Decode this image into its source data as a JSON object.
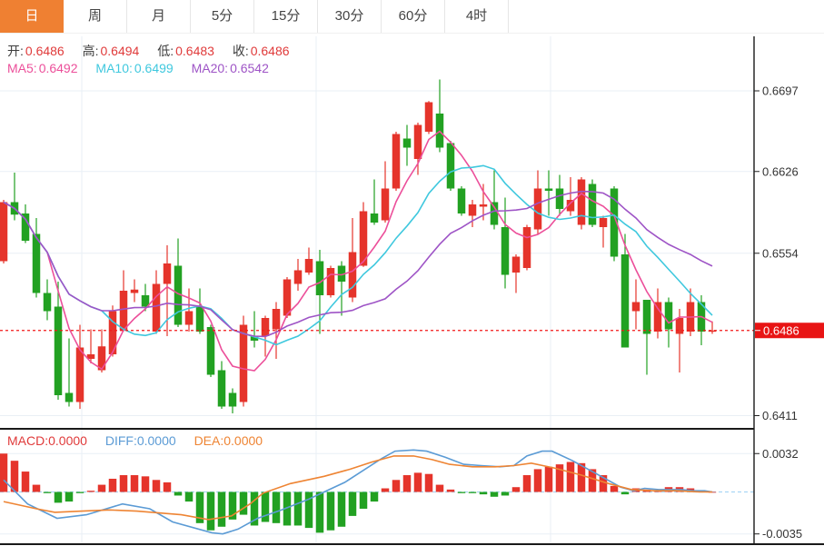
{
  "tabs": [
    {
      "name": "tab-day",
      "label": "日",
      "active": true
    },
    {
      "name": "tab-week",
      "label": "周",
      "active": false
    },
    {
      "name": "tab-month",
      "label": "月",
      "active": false
    },
    {
      "name": "tab-5min",
      "label": "5分",
      "active": false
    },
    {
      "name": "tab-15min",
      "label": "15分",
      "active": false
    },
    {
      "name": "tab-30min",
      "label": "30分",
      "active": false
    },
    {
      "name": "tab-60min",
      "label": "60分",
      "active": false
    },
    {
      "name": "tab-4hour",
      "label": "4时",
      "active": false
    }
  ],
  "ohlc": {
    "open_label": "开:",
    "open": "0.6486",
    "high_label": "高:",
    "high": "0.6494",
    "low_label": "低:",
    "low": "0.6483",
    "close_label": "收:",
    "close": "0.6486"
  },
  "ma": {
    "ma5_label": "MA5:",
    "ma5": "0.6492",
    "ma10_label": "MA10:",
    "ma10": "0.6499",
    "ma20_label": "MA20:",
    "ma20": "0.6542"
  },
  "macd_header": {
    "macd_label": "MACD:",
    "macd": "0.0000",
    "diff_label": "DIFF:",
    "diff": "0.0000",
    "dea_label": "DEA:",
    "dea": "0.0000"
  },
  "colors": {
    "up": "#e5342b",
    "down": "#22a122",
    "ma5": "#ec4f9a",
    "ma10": "#3fc8de",
    "ma20": "#9e54c6",
    "diff": "#5b9bd5",
    "dea": "#ee8433",
    "tab_active_bg": "#ef8032",
    "value_red": "#e03a3a",
    "price_line": "#f31919",
    "badge_bg": "#e81414",
    "zero_line": "#a9d7f5",
    "grid": "#e9eff5",
    "axis": "#1a1a1a",
    "text_dark": "#333333"
  },
  "chart_data": [
    {
      "type": "candlestick",
      "title": "daily K-line with MA overlays",
      "legend": [
        "MA5",
        "MA10",
        "MA20"
      ],
      "grid": true,
      "y_axis_side": "right",
      "y_ticks": [
        {
          "label": "0.6697",
          "value": 0.6697
        },
        {
          "label": "0.6626",
          "value": 0.6626
        },
        {
          "label": "0.6554",
          "value": 0.6554
        },
        {
          "label": "0.6411",
          "value": 0.6411
        }
      ],
      "current_price": {
        "label": "0.6486",
        "value": 0.6486
      },
      "ohlc_keys": [
        "open",
        "close",
        "low",
        "high"
      ],
      "candles": [
        [
          0.6547,
          0.6599,
          0.6545,
          0.6601
        ],
        [
          0.6599,
          0.6588,
          0.6583,
          0.6625
        ],
        [
          0.6589,
          0.6565,
          0.6563,
          0.6597
        ],
        [
          0.6571,
          0.6519,
          0.6515,
          0.6585
        ],
        [
          0.6519,
          0.6503,
          0.6495,
          0.6531
        ],
        [
          0.6507,
          0.6429,
          0.6425,
          0.6529
        ],
        [
          0.6431,
          0.6423,
          0.6419,
          0.6479
        ],
        [
          0.6423,
          0.6471,
          0.6417,
          0.6491
        ],
        [
          0.6461,
          0.6465,
          0.6457,
          0.6487
        ],
        [
          0.6451,
          0.6472,
          0.6449,
          0.6487
        ],
        [
          0.6465,
          0.6503,
          0.6463,
          0.6508
        ],
        [
          0.6486,
          0.6521,
          0.6485,
          0.6539
        ],
        [
          0.6519,
          0.6522,
          0.6511,
          0.6531
        ],
        [
          0.6517,
          0.6507,
          0.6503,
          0.6527
        ],
        [
          0.6485,
          0.6527,
          0.6483,
          0.6539
        ],
        [
          0.6527,
          0.6545,
          0.6481,
          0.6561
        ],
        [
          0.6543,
          0.6491,
          0.6489,
          0.6567
        ],
        [
          0.6491,
          0.6503,
          0.6485,
          0.6523
        ],
        [
          0.6507,
          0.6485,
          0.6483,
          0.6523
        ],
        [
          0.6489,
          0.6447,
          0.6445,
          0.6491
        ],
        [
          0.6451,
          0.6419,
          0.6417,
          0.6459
        ],
        [
          0.6431,
          0.6419,
          0.6413,
          0.6435
        ],
        [
          0.6423,
          0.6491,
          0.6419,
          0.6499
        ],
        [
          0.6481,
          0.6477,
          0.6471,
          0.6503
        ],
        [
          0.6481,
          0.6497,
          0.6463,
          0.6499
        ],
        [
          0.6487,
          0.6505,
          0.6461,
          0.6511
        ],
        [
          0.6499,
          0.6531,
          0.6497,
          0.6533
        ],
        [
          0.6527,
          0.6539,
          0.6521,
          0.6549
        ],
        [
          0.6537,
          0.6549,
          0.6535,
          0.6559
        ],
        [
          0.6547,
          0.6517,
          0.6483,
          0.6557
        ],
        [
          0.6517,
          0.6541,
          0.6515,
          0.6543
        ],
        [
          0.6543,
          0.6529,
          0.6499,
          0.6547
        ],
        [
          0.6515,
          0.6555,
          0.6511,
          0.6585
        ],
        [
          0.6543,
          0.6591,
          0.6542,
          0.6599
        ],
        [
          0.6589,
          0.6581,
          0.6579,
          0.6619
        ],
        [
          0.6583,
          0.6611,
          0.6581,
          0.6635
        ],
        [
          0.6611,
          0.6659,
          0.6609,
          0.6661
        ],
        [
          0.6655,
          0.6647,
          0.6631,
          0.6667
        ],
        [
          0.6637,
          0.6667,
          0.6623,
          0.6669
        ],
        [
          0.6661,
          0.6687,
          0.6659,
          0.6688
        ],
        [
          0.6677,
          0.6647,
          0.6643,
          0.6707
        ],
        [
          0.6651,
          0.6611,
          0.6609,
          0.6653
        ],
        [
          0.6611,
          0.6589,
          0.6587,
          0.6613
        ],
        [
          0.6587,
          0.6597,
          0.6577,
          0.6601
        ],
        [
          0.6595,
          0.6597,
          0.6583,
          0.6615
        ],
        [
          0.6599,
          0.6579,
          0.6575,
          0.6627
        ],
        [
          0.6577,
          0.6535,
          0.6523,
          0.6603
        ],
        [
          0.6537,
          0.6551,
          0.6519,
          0.6553
        ],
        [
          0.6541,
          0.6577,
          0.6539,
          0.6579
        ],
        [
          0.6575,
          0.6611,
          0.6571,
          0.6627
        ],
        [
          0.6611,
          0.6609,
          0.6587,
          0.6627
        ],
        [
          0.6611,
          0.6593,
          0.6587,
          0.6623
        ],
        [
          0.6591,
          0.6601,
          0.6587,
          0.6621
        ],
        [
          0.6579,
          0.6619,
          0.6575,
          0.6621
        ],
        [
          0.6615,
          0.6579,
          0.6577,
          0.6619
        ],
        [
          0.6577,
          0.6585,
          0.6559,
          0.6587
        ],
        [
          0.6611,
          0.6551,
          0.6547,
          0.6613
        ],
        [
          0.6553,
          0.6471,
          0.6471,
          0.6571
        ],
        [
          0.6503,
          0.6511,
          0.6487,
          0.6531
        ],
        [
          0.6513,
          0.6483,
          0.6447,
          0.6513
        ],
        [
          0.6485,
          0.6511,
          0.6479,
          0.6523
        ],
        [
          0.6511,
          0.6487,
          0.6471,
          0.6515
        ],
        [
          0.6483,
          0.6497,
          0.6449,
          0.6505
        ],
        [
          0.6485,
          0.6511,
          0.6481,
          0.6523
        ],
        [
          0.6511,
          0.6485,
          0.6473,
          0.6517
        ],
        [
          0.6486,
          0.6486,
          0.6483,
          0.6494
        ]
      ],
      "overlays": [
        {
          "name": "MA5",
          "period": 5,
          "color_key": "ma5"
        },
        {
          "name": "MA10",
          "period": 10,
          "color_key": "ma10"
        },
        {
          "name": "MA20",
          "period": 20,
          "color_key": "ma20"
        }
      ]
    },
    {
      "type": "bar",
      "title": "MACD",
      "y_ticks": [
        {
          "label": "0.0032",
          "value": 0.0032
        },
        {
          "label": "-0.0035",
          "value": -0.0035
        }
      ],
      "zero_line_dashed": true,
      "values": [
        0.0032,
        0.0026,
        0.0017,
        0.0006,
        -0.0001,
        -0.0009,
        -0.0008,
        -0.0001,
        0.0001,
        0.0006,
        0.0011,
        0.0014,
        0.0014,
        0.0013,
        0.001,
        0.0008,
        -0.0003,
        -0.0008,
        -0.0026,
        -0.0032,
        -0.0029,
        -0.0023,
        -0.0019,
        -0.0028,
        -0.0025,
        -0.0026,
        -0.0028,
        -0.0028,
        -0.003,
        -0.0034,
        -0.0032,
        -0.0029,
        -0.002,
        -0.0014,
        -0.0008,
        0.0003,
        0.001,
        0.0014,
        0.0016,
        0.0015,
        0.0006,
        0.0002,
        -0.0001,
        -0.0001,
        -0.0002,
        -0.0004,
        -0.0003,
        0.0004,
        0.0014,
        0.0019,
        0.0021,
        0.0023,
        0.0025,
        0.0024,
        0.0019,
        0.0014,
        0.0005,
        -0.0002,
        0.0003,
        0.0002,
        0.0001,
        0.0004,
        0.0004,
        0.0003,
        0.0001,
        0.0
      ],
      "diff_line": [
        [
          0,
          0.001
        ],
        [
          2.2,
          -0.001
        ],
        [
          4.9,
          -0.0022
        ],
        [
          7.6,
          -0.0019
        ],
        [
          10.9,
          -0.001
        ],
        [
          13.4,
          -0.0014
        ],
        [
          15.5,
          -0.0025
        ],
        [
          19.1,
          -0.0034
        ],
        [
          20.1,
          -0.0035
        ],
        [
          21.5,
          -0.0031
        ],
        [
          23.3,
          -0.0022
        ],
        [
          25.5,
          -0.0015
        ],
        [
          28,
          -0.0006
        ],
        [
          29.4,
          0
        ],
        [
          31.3,
          0.0008
        ],
        [
          33,
          0.0018
        ],
        [
          34.7,
          0.0028
        ],
        [
          35.9,
          0.0034
        ],
        [
          37.6,
          0.0035
        ],
        [
          38.8,
          0.0034
        ],
        [
          40.5,
          0.0029
        ],
        [
          42.2,
          0.0023
        ],
        [
          43.8,
          0.0022
        ],
        [
          45.5,
          0.0021
        ],
        [
          46.8,
          0.0022
        ],
        [
          48,
          0.003
        ],
        [
          49.4,
          0.0034
        ],
        [
          50.3,
          0.0034
        ],
        [
          52.2,
          0.0026
        ],
        [
          54.4,
          0.0015
        ],
        [
          56.6,
          0.0004
        ],
        [
          57.8,
          0.0001
        ],
        [
          58.8,
          0.0003
        ],
        [
          60.1,
          0.0002
        ],
        [
          61.1,
          0.0002
        ],
        [
          62.2,
          0.0002
        ],
        [
          63.2,
          0.0001
        ],
        [
          64.3,
          0.0001
        ],
        [
          65,
          0.0
        ]
      ],
      "dea_line": [
        [
          0,
          -0.0008
        ],
        [
          3,
          -0.0014
        ],
        [
          4.7,
          -0.0017
        ],
        [
          7.2,
          -0.0016
        ],
        [
          9.7,
          -0.0015
        ],
        [
          12.2,
          -0.0016
        ],
        [
          16.3,
          -0.0019
        ],
        [
          18.8,
          -0.0023
        ],
        [
          20.9,
          -0.002
        ],
        [
          22.6,
          -0.001
        ],
        [
          23.8,
          -0.0001
        ],
        [
          26.3,
          0.0007
        ],
        [
          29.4,
          0.0013
        ],
        [
          31.8,
          0.0019
        ],
        [
          33.8,
          0.0025
        ],
        [
          35.8,
          0.003
        ],
        [
          37.6,
          0.003
        ],
        [
          39.3,
          0.0027
        ],
        [
          40.9,
          0.0023
        ],
        [
          43,
          0.0021
        ],
        [
          45.1,
          0.0021
        ],
        [
          46.8,
          0.0022
        ],
        [
          48.4,
          0.0024
        ],
        [
          50.5,
          0.002
        ],
        [
          53,
          0.0014
        ],
        [
          55.5,
          0.0007
        ],
        [
          57.6,
          0.0002
        ],
        [
          59.7,
          0.0001
        ],
        [
          61.8,
          0.0001
        ],
        [
          63.8,
          0
        ],
        [
          65,
          0
        ]
      ]
    }
  ]
}
